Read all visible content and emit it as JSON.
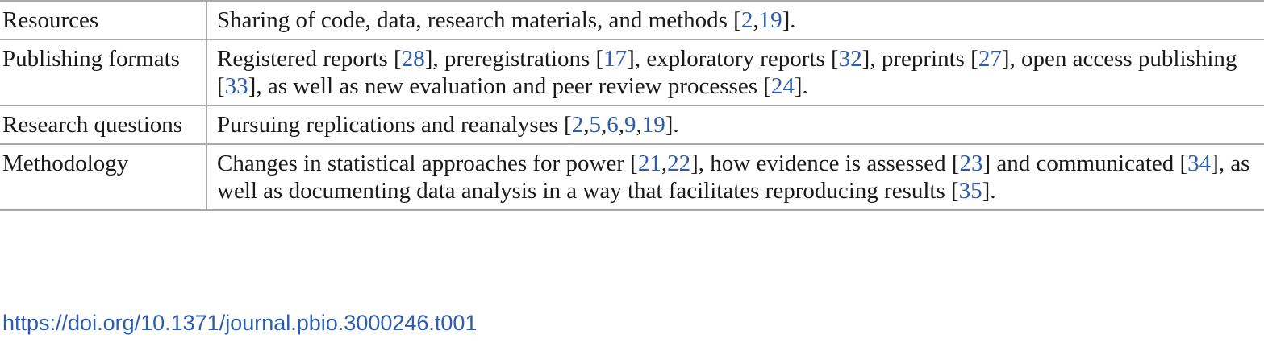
{
  "table": {
    "rows": [
      {
        "label": "Resources",
        "segments": [
          {
            "t": "Sharing of code, data, research materials, and methods ["
          },
          {
            "t": "2",
            "ref": true
          },
          {
            "t": ","
          },
          {
            "t": "19",
            "ref": true
          },
          {
            "t": "]."
          }
        ]
      },
      {
        "label": "Publishing formats",
        "segments": [
          {
            "t": "Registered reports ["
          },
          {
            "t": "28",
            "ref": true
          },
          {
            "t": "], preregistrations ["
          },
          {
            "t": "17",
            "ref": true
          },
          {
            "t": "], exploratory reports ["
          },
          {
            "t": "32",
            "ref": true
          },
          {
            "t": "], preprints ["
          },
          {
            "t": "27",
            "ref": true
          },
          {
            "t": "], open access publishing ["
          },
          {
            "t": "33",
            "ref": true
          },
          {
            "t": "], as well as new evaluation and peer review processes ["
          },
          {
            "t": "24",
            "ref": true
          },
          {
            "t": "]."
          }
        ]
      },
      {
        "label": "Research questions",
        "segments": [
          {
            "t": "Pursuing replications and reanalyses ["
          },
          {
            "t": "2",
            "ref": true
          },
          {
            "t": ","
          },
          {
            "t": "5",
            "ref": true
          },
          {
            "t": ","
          },
          {
            "t": "6",
            "ref": true
          },
          {
            "t": ","
          },
          {
            "t": "9",
            "ref": true
          },
          {
            "t": ","
          },
          {
            "t": "19",
            "ref": true
          },
          {
            "t": "]."
          }
        ]
      },
      {
        "label": "Methodology",
        "segments": [
          {
            "t": "Changes in statistical approaches for power ["
          },
          {
            "t": "21",
            "ref": true
          },
          {
            "t": ","
          },
          {
            "t": "22",
            "ref": true
          },
          {
            "t": "], how evidence is assessed ["
          },
          {
            "t": "23",
            "ref": true
          },
          {
            "t": "] and communicated ["
          },
          {
            "t": "34",
            "ref": true
          },
          {
            "t": "], as well as documenting data analysis in a way that facilitates reproducing results ["
          },
          {
            "t": "35",
            "ref": true
          },
          {
            "t": "]."
          }
        ]
      }
    ]
  },
  "doi": {
    "text": "https://doi.org/10.1371/journal.pbio.3000246.t001"
  },
  "colors": {
    "link": "#2a5db0",
    "rule": "#a9a9a9",
    "text": "#1a1a1a"
  }
}
